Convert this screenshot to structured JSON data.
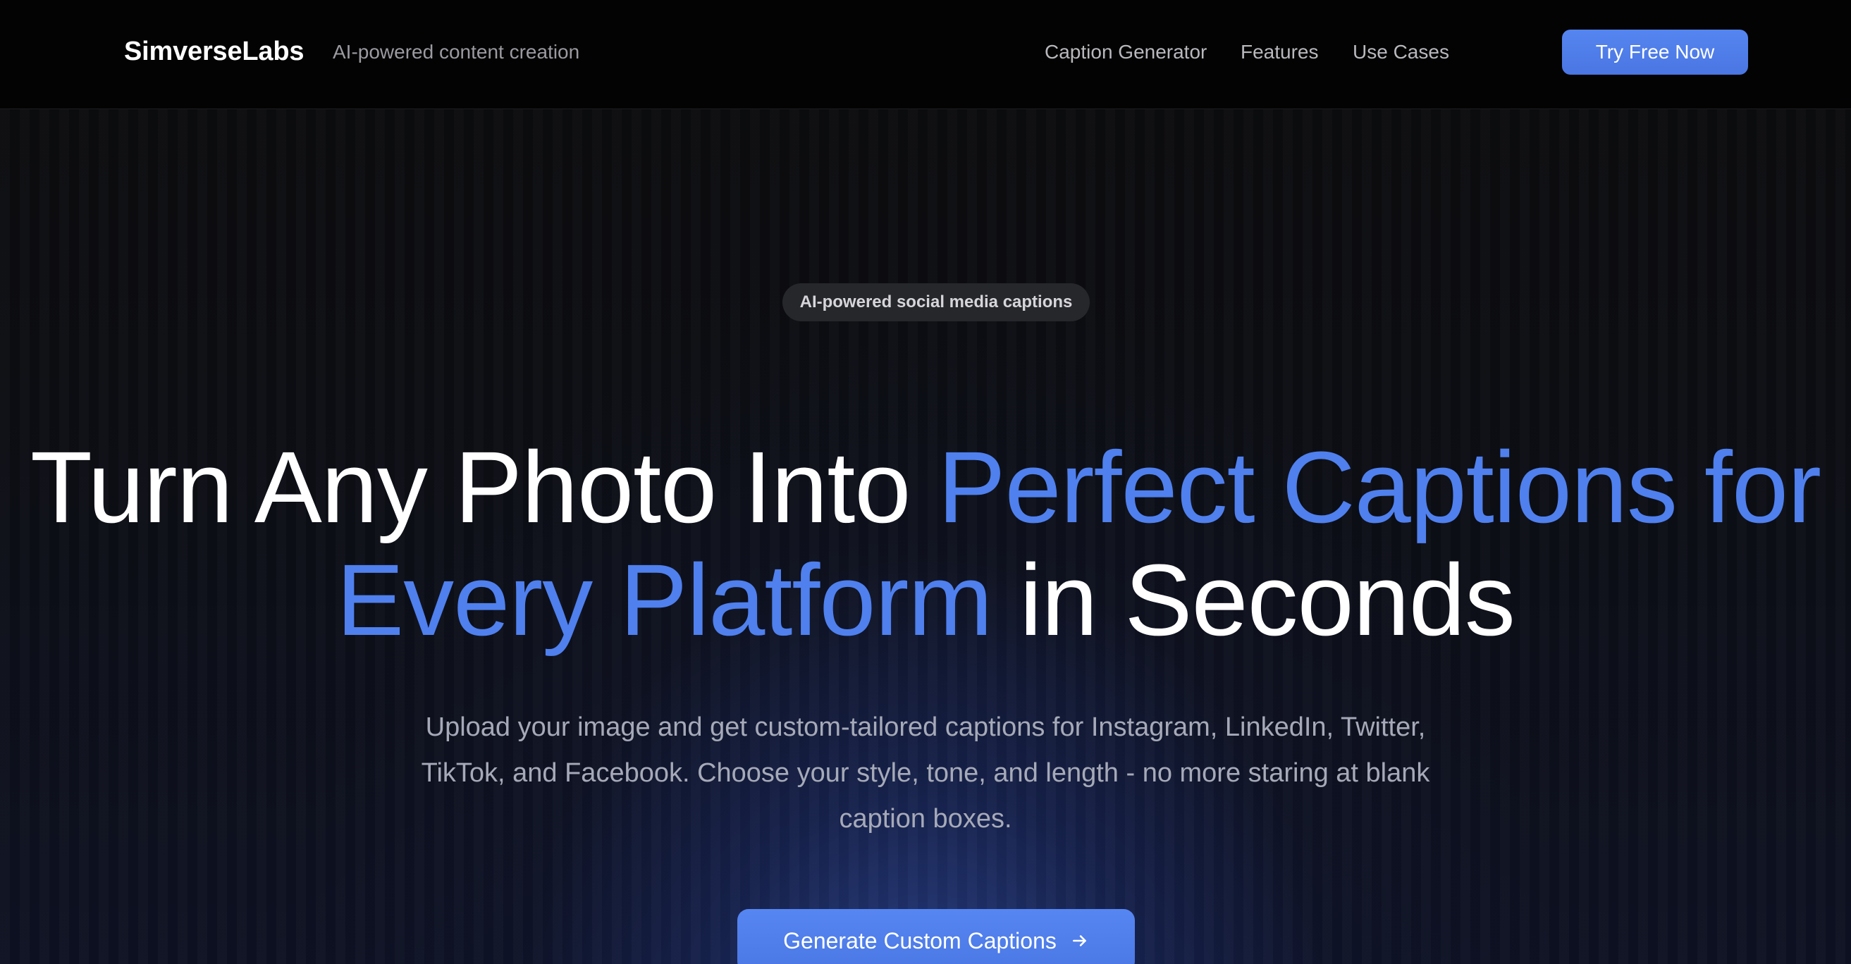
{
  "header": {
    "brand": "SimverseLabs",
    "tagline": "AI-powered content creation",
    "nav": [
      {
        "label": "Caption Generator"
      },
      {
        "label": "Features"
      },
      {
        "label": "Use Cases"
      }
    ],
    "cta_label": "Try Free Now"
  },
  "hero": {
    "badge": "AI-powered social media captions",
    "headline": {
      "part1": "Turn Any Photo Into ",
      "accent1": "Perfect Captions for",
      "accent2": "Every Platform",
      "part2": " in Seconds"
    },
    "subtitle": "Upload your image and get custom-tailored captions for Instagram, LinkedIn, Twitter, TikTok, and Facebook. Choose your style, tone, and length - no more staring at blank caption boxes.",
    "cta_label": "Generate Custom Captions",
    "cta_icon": "arrow-right-icon"
  },
  "colors": {
    "accent": "#4f80ee",
    "button": "#4a76e2",
    "background": "#0a0a0b"
  }
}
